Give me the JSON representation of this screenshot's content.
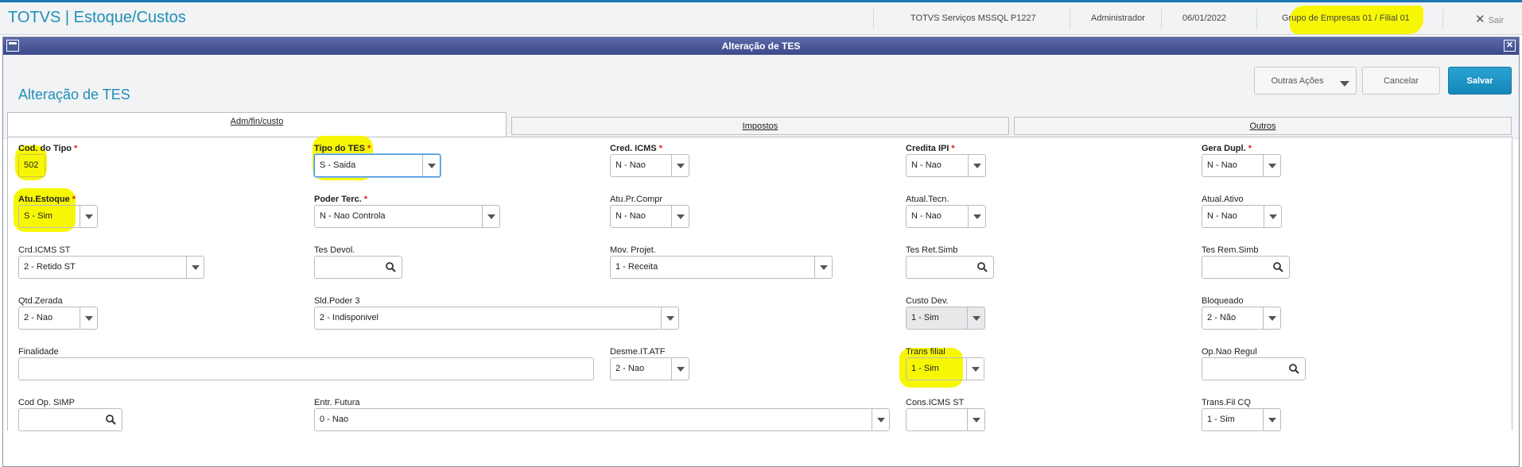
{
  "header": {
    "app_title": "TOTVS | Estoque/Custos",
    "environment": "TOTVS Serviços MSSQL P1227",
    "user": "Administrador",
    "date": "06/01/2022",
    "company": "Grupo de Empresas 01 / Filial 01",
    "exit_label": "Sair"
  },
  "window": {
    "title": "Alteração de TES"
  },
  "page": {
    "title": "Alteração de TES"
  },
  "actions": {
    "more": "Outras Ações",
    "cancel": "Cancelar",
    "save": "Salvar"
  },
  "tabs": [
    "Adm/fin/custo",
    "Impostos",
    "Outros"
  ],
  "fields": {
    "cod_tipo": {
      "label": "Cod. do Tipo",
      "value": "502"
    },
    "tipo_tes": {
      "label": "Tipo do TES",
      "value": "S - Saida"
    },
    "cred_icms": {
      "label": "Cred. ICMS",
      "value": "N - Nao"
    },
    "credita_ipi": {
      "label": "Credita IPI",
      "value": "N - Nao"
    },
    "gera_dupl": {
      "label": "Gera Dupl.",
      "value": "N - Nao"
    },
    "atu_estoque": {
      "label": "Atu.Estoque",
      "value": "S - Sim"
    },
    "poder_terc": {
      "label": "Poder Terc.",
      "value": "N - Nao Controla"
    },
    "atu_pr_compr": {
      "label": "Atu.Pr.Compr",
      "value": "N - Nao"
    },
    "atual_tecn": {
      "label": "Atual.Tecn.",
      "value": "N - Nao"
    },
    "atual_ativo": {
      "label": "Atual.Ativo",
      "value": "N - Nao"
    },
    "crd_icms_st": {
      "label": "Crd.ICMS ST",
      "value": "2 - Retido ST"
    },
    "tes_devol": {
      "label": "Tes Devol.",
      "value": ""
    },
    "mov_projet": {
      "label": "Mov. Projet.",
      "value": "1 - Receita"
    },
    "tes_ret_simb": {
      "label": "Tes Ret.Simb",
      "value": ""
    },
    "tes_rem_simb": {
      "label": "Tes Rem.Simb",
      "value": ""
    },
    "qtd_zerada": {
      "label": "Qtd.Zerada",
      "value": "2 - Nao"
    },
    "sld_poder3": {
      "label": "Sld.Poder 3",
      "value": "2 - Indisponivel"
    },
    "custo_dev": {
      "label": "Custo Dev.",
      "value": "1 - Sim"
    },
    "bloqueado": {
      "label": "Bloqueado",
      "value": "2 - Não"
    },
    "finalidade": {
      "label": "Finalidade",
      "value": ""
    },
    "desme_it_atf": {
      "label": "Desme.IT.ATF",
      "value": "2 - Nao"
    },
    "trans_filial": {
      "label": "Trans filial",
      "value": "1 - Sim"
    },
    "op_nao_regul": {
      "label": "Op.Nao Regul",
      "value": ""
    },
    "cod_op_simp": {
      "label": "Cod Op. SIMP",
      "value": ""
    },
    "entr_futura": {
      "label": "Entr. Futura",
      "value": "0 - Nao"
    },
    "cons_icms_st": {
      "label": "Cons.ICMS ST",
      "value": ""
    },
    "trans_fil_cq": {
      "label": "Trans.Fil CQ",
      "value": "1 - Sim"
    }
  },
  "colors": {
    "accent": "#1f8fb9",
    "highlight": "#f7f705",
    "required": "#e02020",
    "titlebar": "#3c4a8c"
  }
}
